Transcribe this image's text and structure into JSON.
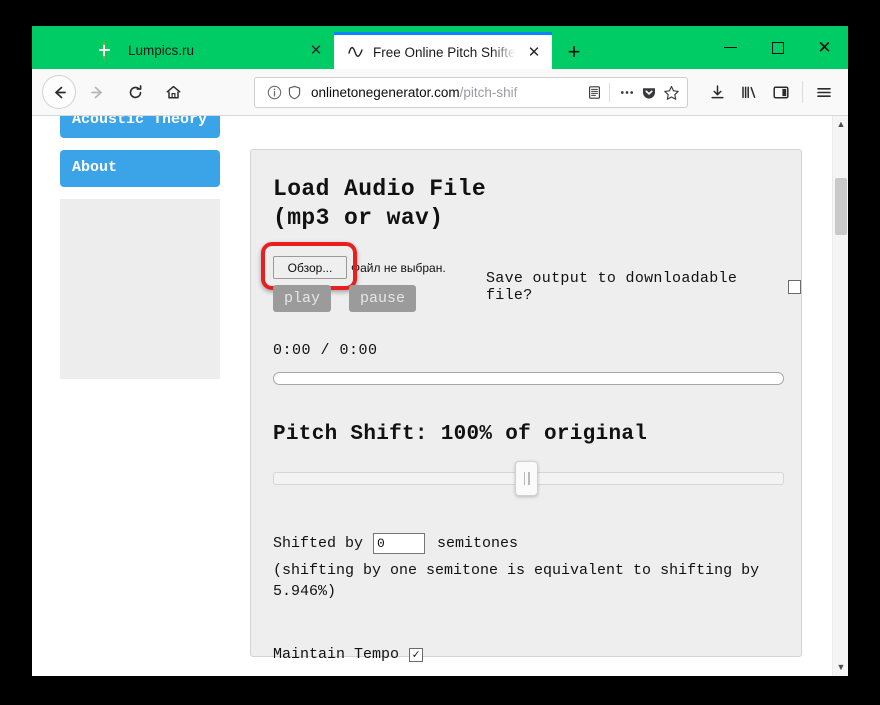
{
  "browser": {
    "titlebar_color": "#00cc66",
    "tabs": [
      {
        "label": "Lumpics.ru",
        "favicon": "orange-slice-icon",
        "active": false,
        "close_label": "✕"
      },
      {
        "label": "Free Online Pitch Shifter | Onlin",
        "favicon": "waveform-icon",
        "active": true,
        "close_label": "✕"
      }
    ],
    "new_tab_label": "+",
    "window_controls": {
      "minimize": "minimize-icon",
      "maximize": "maximize-icon",
      "close": "close-icon"
    },
    "nav": {
      "back": "back-arrow-icon",
      "forward": "forward-arrow-icon",
      "reload": "reload-icon",
      "home": "home-icon"
    },
    "urlbar": {
      "info_icon": "info-circle-icon",
      "shield_icon": "shield-icon",
      "url_domain": "onlinetonegenerator.com",
      "url_path": "/pitch-shif",
      "reader_icon": "reader-view-icon",
      "more_icon": "page-actions-ellipsis-icon",
      "pocket_icon": "pocket-icon",
      "bookmark_icon": "star-icon"
    },
    "toolbar": {
      "downloads": "download-icon",
      "library": "library-icon",
      "sidebars": "sidebar-toggle-icon",
      "menu": "hamburger-menu-icon"
    }
  },
  "page": {
    "sidebar": {
      "items": [
        {
          "label": "Acoustic\nTheory",
          "color": "#3ba3e8"
        },
        {
          "label": "About",
          "color": "#3ba3e8"
        }
      ],
      "ad_placeholder": ""
    },
    "card": {
      "title": "Load Audio File\n(mp3 or wav)",
      "file_input": {
        "button_label": "Обзор...",
        "status_text": "Файл не выбран.",
        "highlight_color": "#e81f1f"
      },
      "play_label": "play",
      "pause_label": "pause",
      "save_output_label": "Save output to downloadable file?",
      "save_output_checked": "",
      "timecode": "0:00 / 0:00",
      "progress_value": 0,
      "pitch_label": "Pitch Shift: 100% of original",
      "pitch_percent": 100,
      "pitch_slider_position_percent": 48,
      "shifted_by_prefix": "Shifted by",
      "semitones_value": "0",
      "semitones_suffix": "semitones",
      "semitone_note": "(shifting by one semitone is equivalent to shifting by 5.946%)",
      "maintain_tempo_label": "Maintain Tempo",
      "maintain_tempo_checked": "✓"
    },
    "scrollbar": {
      "up_arrow": "▲",
      "down_arrow": "▼"
    }
  }
}
